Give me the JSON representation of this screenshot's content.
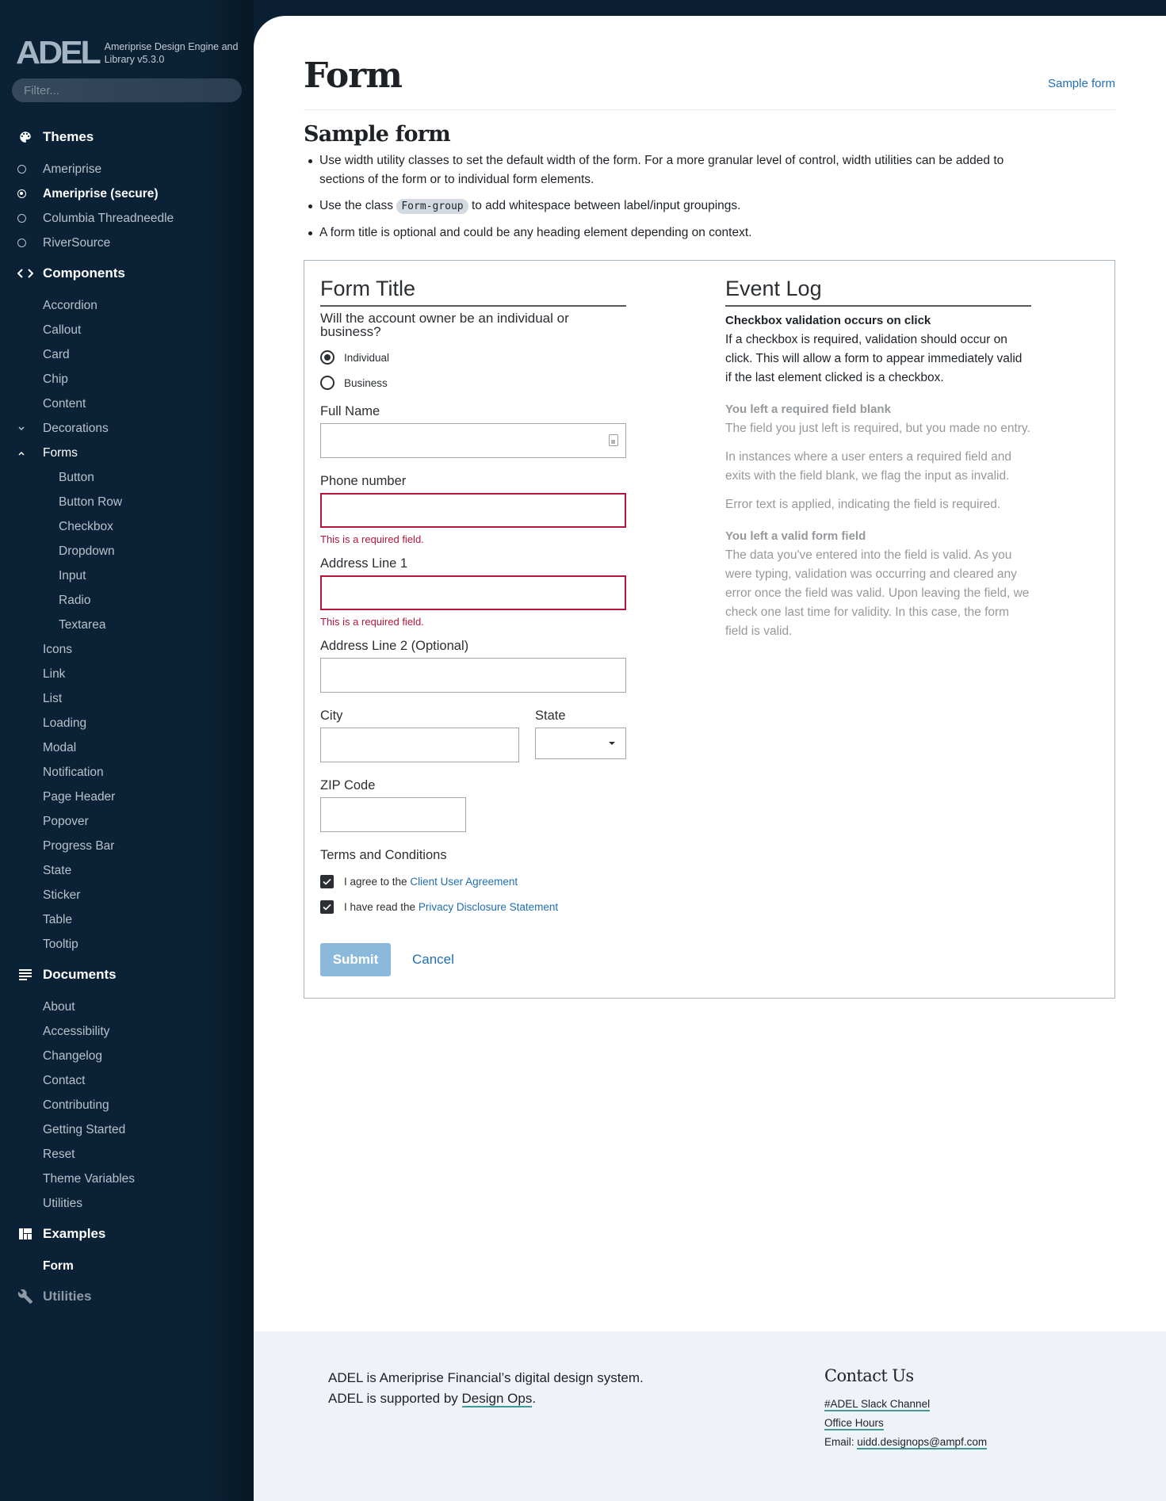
{
  "brand": {
    "logo": "ADEL",
    "subtitle": "Ameriprise Design Engine and Library v5.3.0",
    "filter_placeholder": "Filter..."
  },
  "sidebar": {
    "themes": {
      "label": "Themes",
      "icon": "palette-icon",
      "items": [
        {
          "label": "Ameriprise",
          "selected": false
        },
        {
          "label": "Ameriprise (secure)",
          "selected": true
        },
        {
          "label": "Columbia Threadneedle",
          "selected": false
        },
        {
          "label": "RiverSource",
          "selected": false
        }
      ]
    },
    "components": {
      "label": "Components",
      "icon": "code-icon",
      "items_before": [
        "Accordion",
        "Callout",
        "Card",
        "Chip",
        "Content"
      ],
      "decorations": {
        "label": "Decorations",
        "expanded": false
      },
      "forms": {
        "label": "Forms",
        "expanded": true,
        "children": [
          "Button",
          "Button Row",
          "Checkbox",
          "Dropdown",
          "Input",
          "Radio",
          "Textarea"
        ]
      },
      "items_after": [
        "Icons",
        "Link",
        "List",
        "Loading",
        "Modal",
        "Notification",
        "Page Header",
        "Popover",
        "Progress Bar",
        "State",
        "Sticker",
        "Table",
        "Tooltip"
      ]
    },
    "documents": {
      "label": "Documents",
      "icon": "notes-icon",
      "items": [
        "About",
        "Accessibility",
        "Changelog",
        "Contact",
        "Contributing",
        "Getting Started",
        "Reset",
        "Theme Variables",
        "Utilities"
      ]
    },
    "examples": {
      "label": "Examples",
      "icon": "dashboard-icon",
      "items": [
        {
          "label": "Form",
          "active": true
        }
      ]
    },
    "utilities": {
      "label": "Utilities",
      "icon": "wrench-icon"
    }
  },
  "page": {
    "title": "Form",
    "toc_link": "Sample form",
    "section_title": "Sample form",
    "bullets": {
      "b1": "Use width utility classes to set the default width of the form. For a more granular level of control, width utilities can be added to sections of the form or to individual form elements.",
      "b2_before": "Use the class",
      "b2_code": "Form-group",
      "b2_after": "to add whitespace between label/input groupings.",
      "b3": "A form title is optional and could be any heading element depending on context."
    }
  },
  "form": {
    "title": "Form Title",
    "question": "Will the account owner be an individual or business?",
    "radios": [
      {
        "label": "Individual",
        "checked": true
      },
      {
        "label": "Business",
        "checked": false
      }
    ],
    "full_name": {
      "label": "Full Name",
      "value": ""
    },
    "phone": {
      "label": "Phone number",
      "value": "",
      "error": "This is a required field."
    },
    "address1": {
      "label": "Address Line 1",
      "value": "",
      "error": "This is a required field."
    },
    "address2": {
      "label": "Address Line 2 (Optional)",
      "value": ""
    },
    "city": {
      "label": "City",
      "value": ""
    },
    "state": {
      "label": "State",
      "value": ""
    },
    "zip": {
      "label": "ZIP Code",
      "value": ""
    },
    "terms": {
      "label": "Terms and Conditions",
      "check1": {
        "prefix": "I agree to the",
        "link": "Client User Agreement",
        "checked": true
      },
      "check2": {
        "prefix": "I have read the",
        "link": "Privacy Disclosure Statement",
        "checked": true
      }
    },
    "submit_label": "Submit",
    "cancel_label": "Cancel"
  },
  "event_log": {
    "title": "Event Log",
    "entries": [
      {
        "heading": "Checkbox validation occurs on click",
        "paragraphs": [
          "If a checkbox is required, validation should occur on click. This will allow a form to appear immediately valid if the last element clicked is a checkbox."
        ],
        "dimmed": false
      },
      {
        "heading": "You left a required field blank",
        "paragraphs": [
          "The field you just left is required, but you made no entry.",
          "In instances where a user enters a required field and exits with the field blank, we flag the input as invalid.",
          "Error text is applied, indicating the field is required."
        ],
        "dimmed": true
      },
      {
        "heading": "You left a valid form field",
        "paragraphs": [
          "The data you've entered into the field is valid. As you were typing, validation was occurring and cleared any error once the field was valid. Upon leaving the field, we check one last time for validity. In this case, the form field is valid."
        ],
        "dimmed": true
      }
    ]
  },
  "footer": {
    "line1": "ADEL is Ameriprise Financial’s digital design system.",
    "line2_before": "ADEL is supported by",
    "line2_link": "Design Ops",
    "line2_after": ".",
    "contact_title": "Contact Us",
    "slack": "#ADEL Slack Channel",
    "office_hours": "Office Hours",
    "email_label": "Email:",
    "email": "uidd.designops@ampf.com"
  },
  "colors": {
    "sidebar_bg": "#0b2135",
    "link": "#1f6fb2",
    "error": "#b4163b",
    "submit_disabled": "#8bb9dc",
    "footer_bg": "#eff2f6",
    "underline_accent": "#3d9b94"
  }
}
